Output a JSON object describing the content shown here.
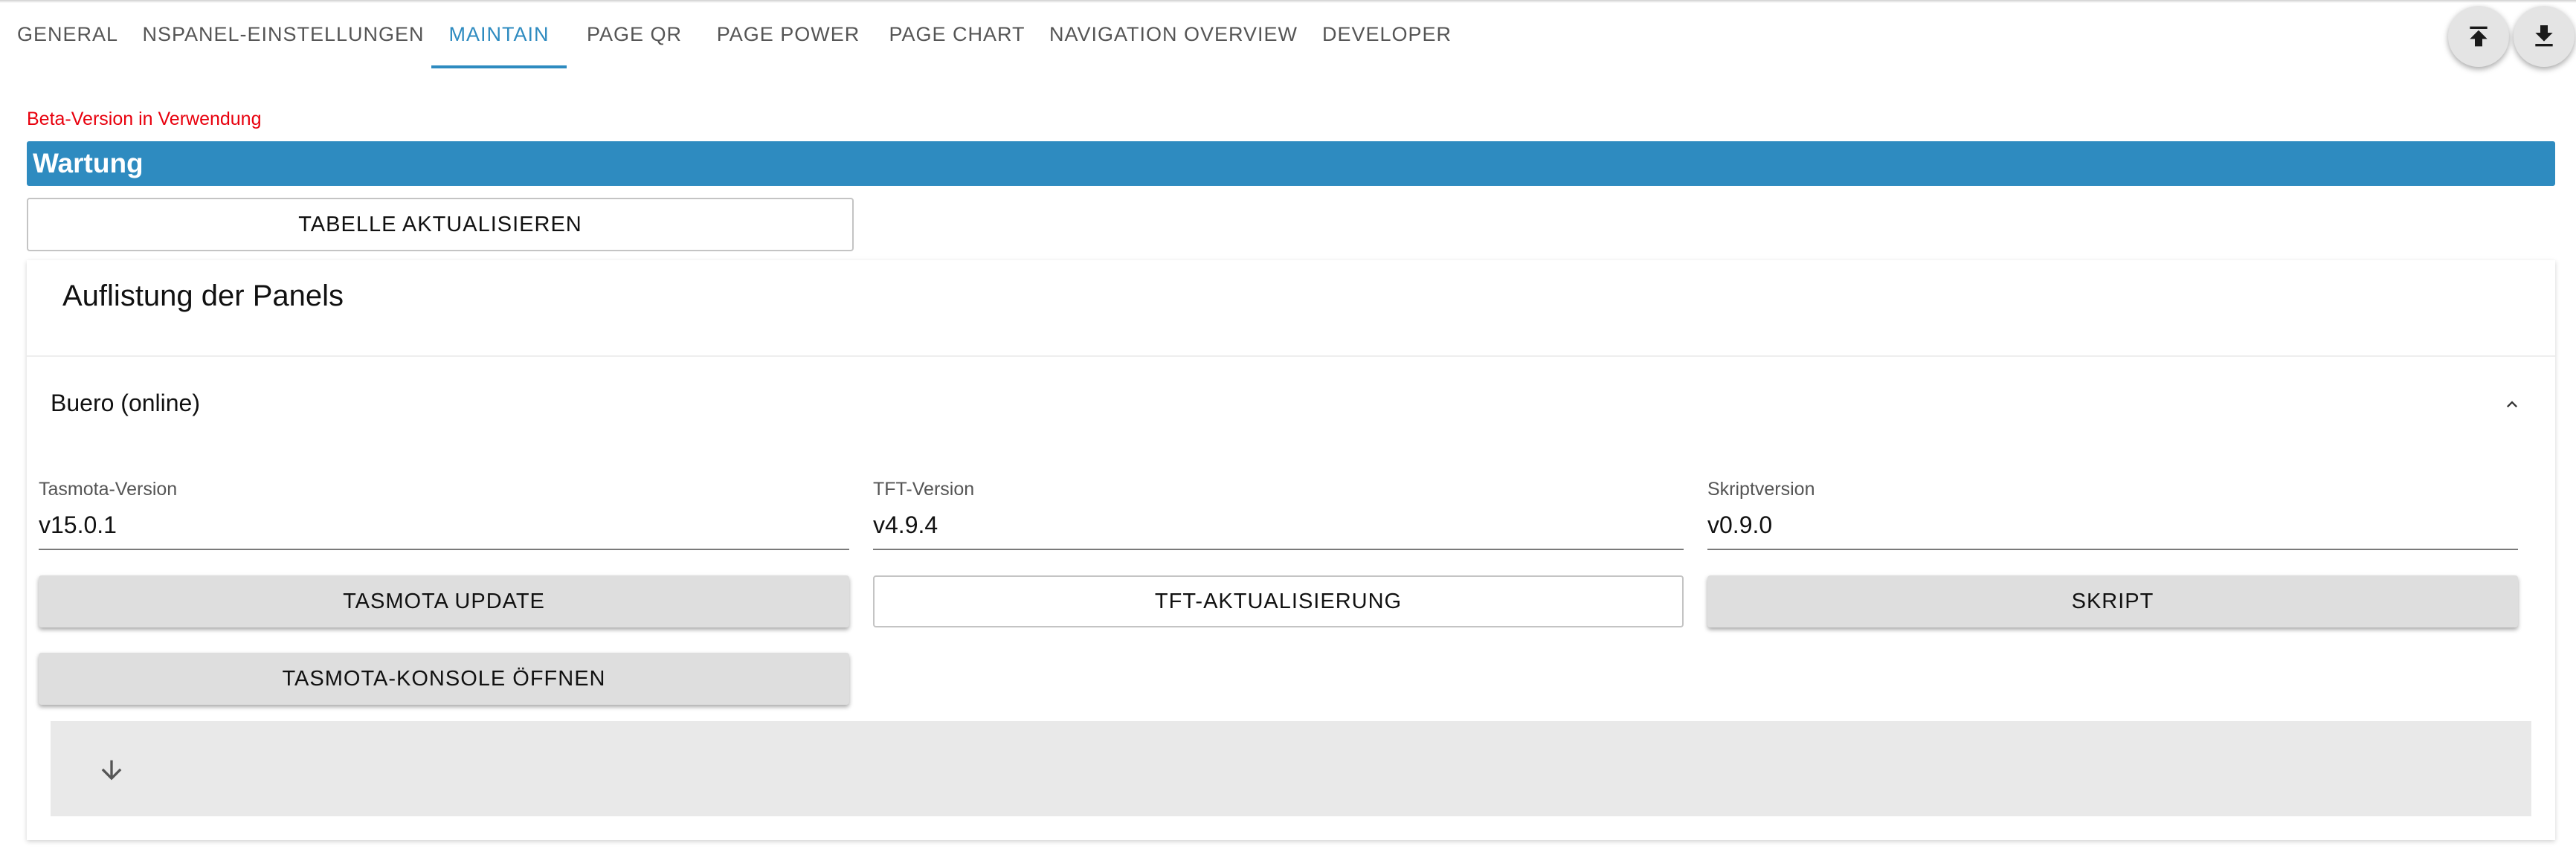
{
  "tabs": [
    {
      "label": "GENERAL"
    },
    {
      "label": "NSPANEL-EINSTELLUNGEN"
    },
    {
      "label": "MAINTAIN"
    },
    {
      "label": "PAGE QR"
    },
    {
      "label": "PAGE POWER"
    },
    {
      "label": "PAGE CHART"
    },
    {
      "label": "NAVIGATION OVERVIEW"
    },
    {
      "label": "DEVELOPER"
    }
  ],
  "active_tab": "MAINTAIN",
  "toolbar": {
    "upload_icon": "upload-icon",
    "download_icon": "download-icon"
  },
  "beta_notice": "Beta-Version in Verwendung",
  "section_title": "Wartung",
  "refresh_button": "TABELLE AKTUALISIEREN",
  "card": {
    "title": "Auflistung der Panels",
    "panel": {
      "title": "Buero (online)",
      "expanded": true,
      "fields": [
        {
          "label": "Tasmota-Version",
          "value": "v15.0.1"
        },
        {
          "label": "TFT-Version",
          "value": "v4.9.4"
        },
        {
          "label": "Skriptversion",
          "value": "v0.9.0"
        }
      ],
      "buttons": {
        "tasmota_update": "TASMOTA UPDATE",
        "tft_update": "TFT-AKTUALISIERUNG",
        "script": "SKRIPT",
        "console": "TASMOTA-KONSOLE ÖFFNEN"
      }
    }
  },
  "colors": {
    "accent": "#2e8bc0",
    "warning": "#e8000d",
    "button_grey": "#dedede"
  }
}
